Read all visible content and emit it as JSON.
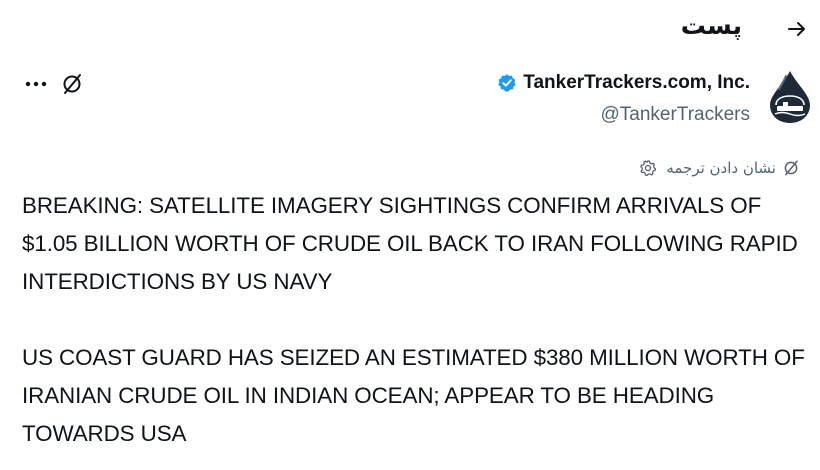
{
  "header": {
    "title": "پست",
    "back_icon": "arrow-right-icon"
  },
  "author": {
    "name": "TankerTrackers.com, Inc.",
    "handle": "@TankerTrackers",
    "verified": true,
    "verified_color": "#1d9bf0"
  },
  "actions": {
    "more_icon": "more-horizontal-icon",
    "grok_icon": "grok-icon"
  },
  "translate": {
    "label": "نشان دادن ترجمه",
    "gear_icon": "gear-icon"
  },
  "post": {
    "paragraphs": [
      "BREAKING: SATELLITE IMAGERY SIGHTINGS CONFIRM ARRIVALS OF $1.05 BILLION WORTH OF CRUDE OIL BACK TO IRAN FOLLOWING RAPID INTERDICTIONS BY US NAVY",
      "US COAST GUARD HAS SEIZED AN ESTIMATED $380 MILLION WORTH OF IRANIAN CRUDE OIL IN INDIAN OCEAN; APPEAR TO BE HEADING TOWARDS USA"
    ]
  },
  "colors": {
    "text": "#0f1419",
    "secondary_text": "#536471",
    "background": "#ffffff",
    "avatar_drop": "#1e2a38"
  }
}
